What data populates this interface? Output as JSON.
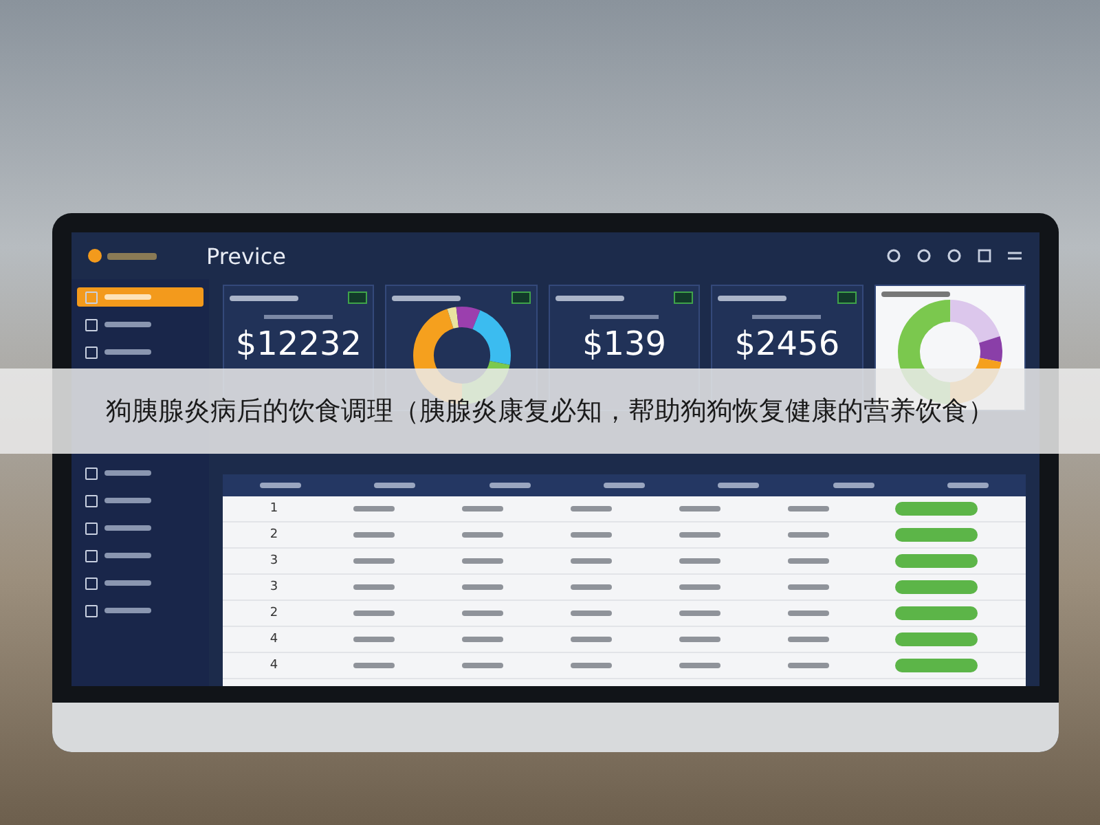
{
  "caption": "狗胰腺炎病后的饮食调理（胰腺炎康复必知，帮助狗狗恢复健康的营养饮食）",
  "dashboard": {
    "title": "Previce",
    "sidebar": {
      "items": [
        {
          "selected": true
        },
        {
          "selected": false
        },
        {
          "selected": false
        }
      ],
      "lower_items": [
        {
          "selected": false
        },
        {
          "selected": false
        },
        {
          "selected": false
        },
        {
          "selected": false
        },
        {
          "selected": false
        },
        {
          "selected": false
        }
      ]
    },
    "cards": [
      {
        "kind": "stat",
        "value": "$12232"
      },
      {
        "kind": "donut"
      },
      {
        "kind": "stat",
        "value": "$139"
      },
      {
        "kind": "stat",
        "value": "$2456"
      },
      {
        "kind": "light-donut"
      }
    ],
    "table": {
      "rows": [
        {
          "index": "1"
        },
        {
          "index": "2"
        },
        {
          "index": "3"
        },
        {
          "index": "3"
        },
        {
          "index": "2"
        },
        {
          "index": "4"
        },
        {
          "index": "4"
        }
      ]
    }
  }
}
